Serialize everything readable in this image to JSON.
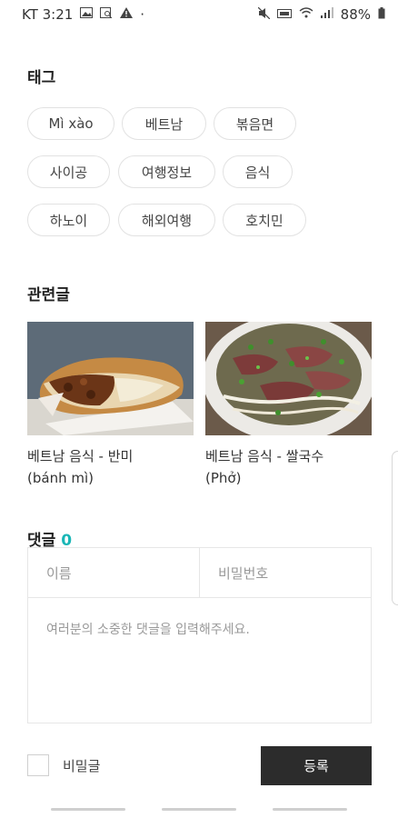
{
  "status": {
    "carrier_time": "KT 3:21",
    "dot": "·",
    "battery": "88%"
  },
  "tags_section": {
    "title": "태그",
    "tags": [
      "Mì xào",
      "베트남",
      "볶음면",
      "사이공",
      "여행정보",
      "음식",
      "하노이",
      "해외여행",
      "호치민"
    ]
  },
  "related": {
    "title": "관련글",
    "posts": [
      {
        "title_line1": "베트남 음식 - 반미",
        "title_line2": "(bánh mì)"
      },
      {
        "title_line1": "베트남 음식 - 쌀국수",
        "title_line2": "(Phở)"
      }
    ]
  },
  "comments": {
    "title": "댓글",
    "count": "0",
    "count_color": "#19b6b6",
    "name_placeholder": "이름",
    "password_placeholder": "비밀번호",
    "content_placeholder": "여러분의 소중한 댓글을 입력해주세요.",
    "secret_label": "비밀글",
    "submit_label": "등록"
  }
}
